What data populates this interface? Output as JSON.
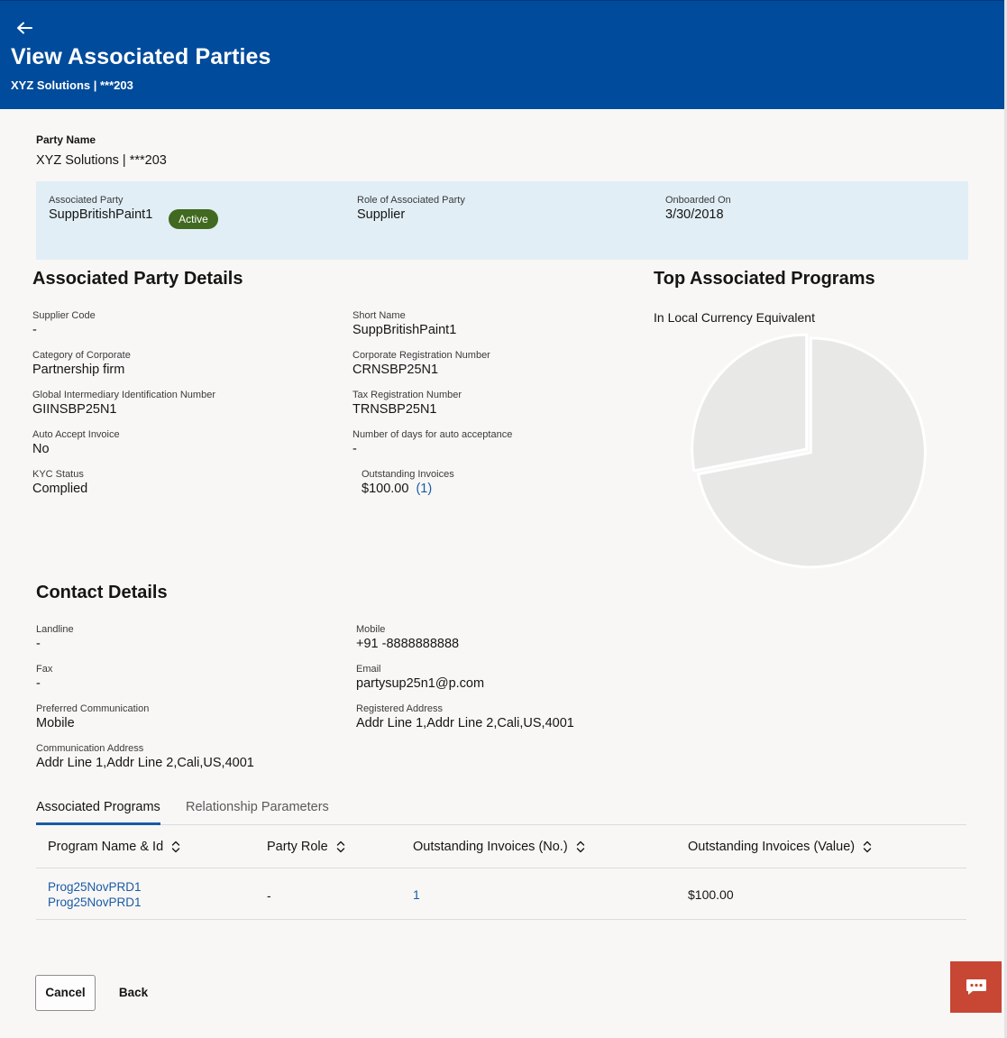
{
  "header": {
    "title": "View Associated Parties",
    "subtitle": "XYZ Solutions | ***203"
  },
  "party": {
    "label": "Party Name",
    "value": "XYZ Solutions | ***203"
  },
  "summary": {
    "associated_party_label": "Associated Party",
    "associated_party_value": "SuppBritishPaint1",
    "status": "Active",
    "role_label": "Role of Associated Party",
    "role_value": "Supplier",
    "onboarded_label": "Onboarded On",
    "onboarded_value": "3/30/2018"
  },
  "details": {
    "title": "Associated Party Details",
    "supplier_code_label": "Supplier Code",
    "supplier_code_value": "-",
    "short_name_label": "Short Name",
    "short_name_value": "SuppBritishPaint1",
    "category_label": "Category of Corporate",
    "category_value": "Partnership firm",
    "corp_reg_label": "Corporate Registration Number",
    "corp_reg_value": "CRNSBP25N1",
    "giin_label": "Global Intermediary Identification Number",
    "giin_value": "GIINSBP25N1",
    "tax_reg_label": "Tax Registration Number",
    "tax_reg_value": "TRNSBP25N1",
    "auto_accept_label": "Auto Accept Invoice",
    "auto_accept_value": "No",
    "days_auto_label": "Number of days for auto acceptance",
    "days_auto_value": "-",
    "kyc_label": "KYC Status",
    "kyc_value": "Complied",
    "outstanding_label": "Outstanding Invoices",
    "outstanding_value": "$100.00",
    "outstanding_count": "(1)"
  },
  "programs_chart": {
    "title": "Top Associated Programs",
    "subtitle": "In Local Currency Equivalent"
  },
  "chart_data": {
    "type": "pie",
    "title": "Top Associated Programs",
    "subtitle": "In Local Currency Equivalent",
    "slices": [
      {
        "value": 72,
        "color": "#e8e8e6"
      },
      {
        "value": 28,
        "color": "#e8e8e6"
      }
    ]
  },
  "contact": {
    "title": "Contact Details",
    "landline_label": "Landline",
    "landline_value": "-",
    "mobile_label": "Mobile",
    "mobile_value": "+91 -8888888888",
    "fax_label": "Fax",
    "fax_value": "-",
    "email_label": "Email",
    "email_value": "partysup25n1@p.com",
    "pref_comm_label": "Preferred Communication",
    "pref_comm_value": "Mobile",
    "reg_address_label": "Registered Address",
    "reg_address_value": "Addr Line 1,Addr Line 2,Cali,US,4001",
    "comm_address_label": "Communication Address",
    "comm_address_value": "Addr Line 1,Addr Line 2,Cali,US,4001"
  },
  "tabs": [
    {
      "label": "Associated Programs",
      "active": true
    },
    {
      "label": "Relationship Parameters",
      "active": false
    }
  ],
  "table": {
    "columns": [
      "Program Name & Id",
      "Party Role",
      "Outstanding Invoices (No.)",
      "Outstanding Invoices (Value)"
    ],
    "rows": [
      {
        "program_name": "Prog25NovPRD1",
        "program_id": "Prog25NovPRD1",
        "party_role": "-",
        "invoices_no": "1",
        "invoices_value": "$100.00"
      }
    ]
  },
  "actions": {
    "cancel": "Cancel",
    "back": "Back"
  },
  "icons": {
    "back": "arrow-left-icon",
    "sort": "sort-icon",
    "chat": "chat-icon"
  },
  "colors": {
    "header_bg": "#004b9b",
    "summary_bg": "#e1eef6",
    "active_pill": "#41691f",
    "link": "#1a5ba4",
    "chat_button": "#c74634"
  }
}
